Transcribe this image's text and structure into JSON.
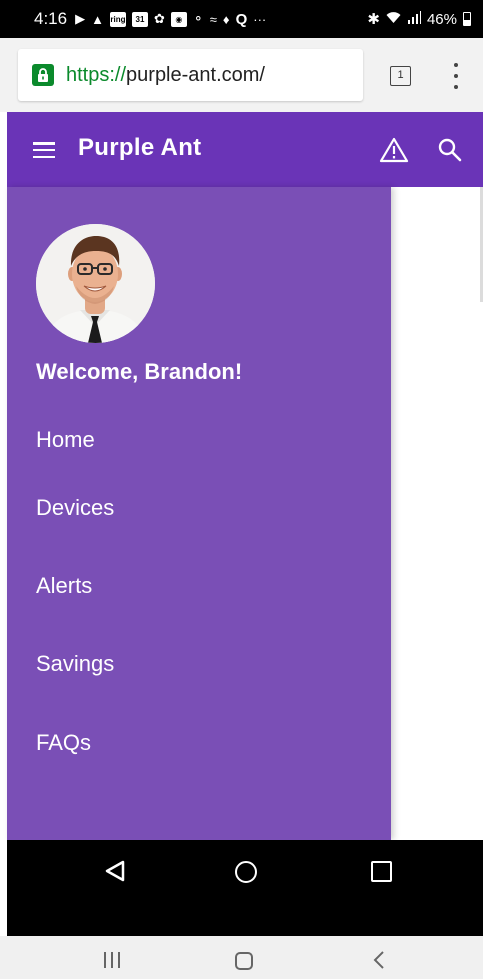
{
  "status_bar": {
    "time": "4:16",
    "notification_icons": [
      "play-icon",
      "warning-icon",
      "ring-icon",
      "calendar-icon",
      "leaf-icon",
      "camera-icon",
      "toyota-icon",
      "script-icon",
      "bird-icon",
      "q-icon",
      "more-dots-icon"
    ],
    "ring_label": "ring",
    "calendar_label": "31",
    "q_label": "Q",
    "more_label": "···",
    "battery_text": "46%"
  },
  "browser": {
    "url_scheme": "https://",
    "url_host": "purple-ant.com/",
    "tab_count": "1"
  },
  "app": {
    "title": "Purple Ant",
    "brand_color": "#6a34b7",
    "drawer_color": "#7a4fb6"
  },
  "drawer": {
    "welcome": "Welcome, Brandon!",
    "items": [
      {
        "label": "Home"
      },
      {
        "label": "Devices"
      },
      {
        "label": "Alerts"
      },
      {
        "label": "Savings"
      },
      {
        "label": "FAQs"
      }
    ]
  }
}
